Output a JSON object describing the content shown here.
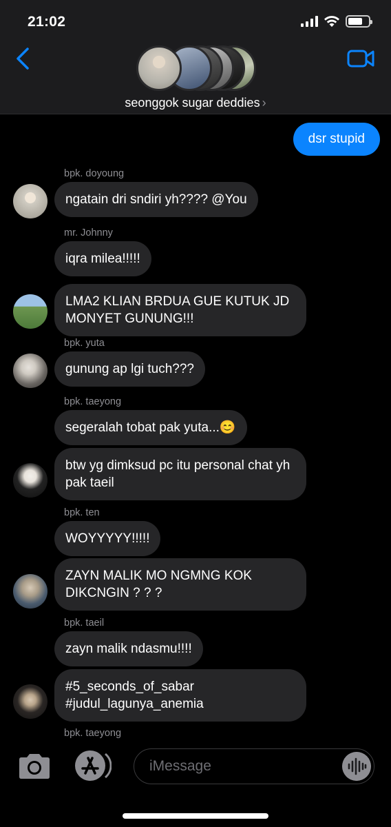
{
  "status": {
    "time": "21:02"
  },
  "header": {
    "group_name": "seonggok sugar deddies",
    "chevron": "›"
  },
  "messages": {
    "outgoing": {
      "text": "dsr stupid"
    },
    "items": [
      {
        "sender": "bpk. doyoung",
        "text": "ngatain dri sndiri yh???? @You"
      },
      {
        "sender": "mr. Johnny",
        "text": "iqra milea!!!!!"
      },
      {
        "sender": "",
        "text": "LMA2 KLIAN BRDUA GUE KUTUK JD MONYET GUNUNG!!!"
      },
      {
        "sender": "bpk. yuta",
        "text": "gunung ap lgi tuch???"
      },
      {
        "sender": "bpk. taeyong",
        "text": "segeralah tobat pak yuta...😊"
      },
      {
        "sender": "",
        "text": "btw yg dimksud pc itu personal chat yh pak taeil"
      },
      {
        "sender": "bpk. ten",
        "text": "WOYYYYY!!!!!"
      },
      {
        "sender": "",
        "text": "ZAYN MALIK MO NGMNG KOK DIKCNGIN ? ? ?"
      },
      {
        "sender": "bpk. taeil",
        "text": "zayn malik ndasmu!!!!"
      },
      {
        "sender": "",
        "text": "#5_seconds_of_sabar #judul_lagunya_anemia"
      },
      {
        "sender": "bpk. taeyong",
        "text": ""
      }
    ]
  },
  "composer": {
    "placeholder": "iMessage"
  },
  "icons": {
    "back": "chevron-left-icon",
    "video": "video-camera-icon",
    "camera": "camera-icon",
    "appstore": "app-store-icon",
    "audio": "audio-waveform-icon"
  },
  "colors": {
    "accent": "#0b84fe",
    "bubble_in": "#262628",
    "header_bg": "#1c1c1e"
  }
}
